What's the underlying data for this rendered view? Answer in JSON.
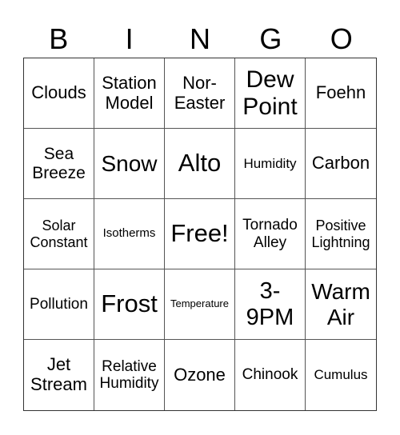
{
  "header": {
    "letters": [
      "B",
      "I",
      "N",
      "G",
      "O"
    ]
  },
  "board": {
    "rows": [
      [
        "Clouds",
        "Station\nModel",
        "Nor-\nEaster",
        "Dew\nPoint",
        "Foehn"
      ],
      [
        "Sea\nBreeze",
        "Snow",
        "Alto",
        "Humidity",
        "Carbon"
      ],
      [
        "Solar\nConstant",
        "Isotherms",
        "Free!",
        "Tornado\nAlley",
        "Positive\nLightning"
      ],
      [
        "Pollution",
        "Frost",
        "Temperature",
        "3-\n9PM",
        "Warm\nAir"
      ],
      [
        "Jet\nStream",
        "Relative\nHumidity",
        "Ozone",
        "Chinook",
        "Cumulus"
      ]
    ]
  }
}
